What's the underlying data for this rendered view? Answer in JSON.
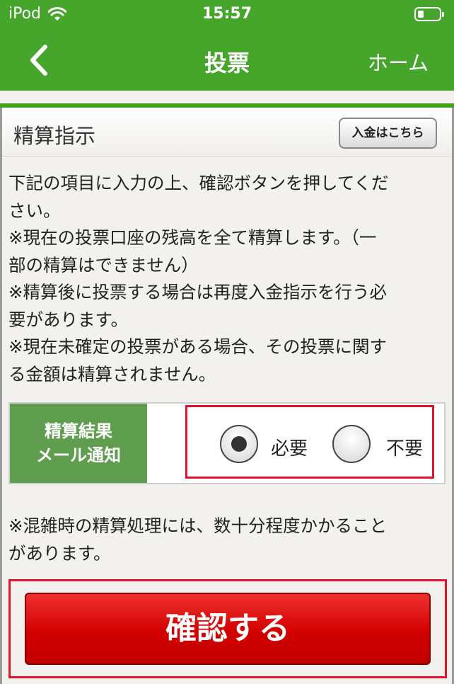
{
  "status": {
    "carrier": "iPod",
    "time": "15:57"
  },
  "nav": {
    "title": "投票",
    "home_label": "ホーム"
  },
  "section": {
    "title": "精算指示",
    "deposit_button": "入金はこちら"
  },
  "instructions": [
    "下記の項目に入力の上、確認ボタンを押してくだ\nさい。",
    "※現在の投票口座の残高を全て精算します。（一\n部の精算はできません）",
    "※精算後に投票する場合は再度入金指示を行う必\n要があります。",
    "※現在未確定の投票がある場合、その投票に関す\nる金額は精算されません。"
  ],
  "setting": {
    "label_line1": "精算結果",
    "label_line2": "メール通知",
    "options": [
      "必要",
      "不要"
    ],
    "selected": "必要"
  },
  "note": "※混雑時の精算処理には、数十分程度かかること\nがあります。",
  "confirm_label": "確認する"
}
